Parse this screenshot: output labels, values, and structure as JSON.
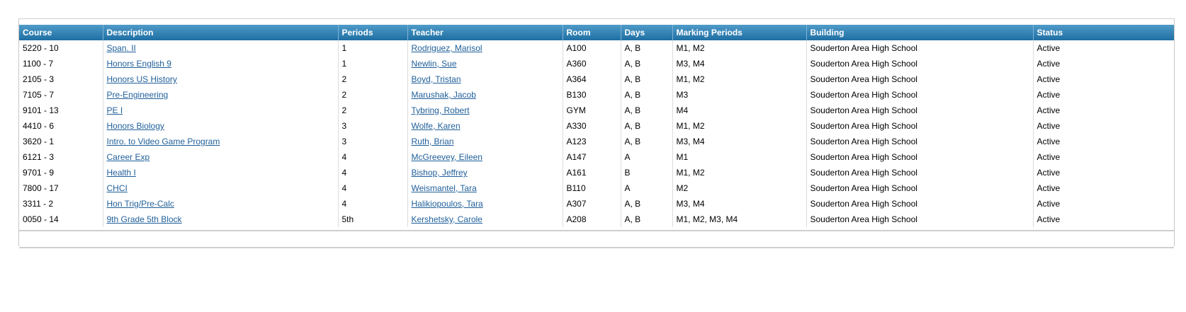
{
  "columns": [
    "Course",
    "Description",
    "Periods",
    "Teacher",
    "Room",
    "Days",
    "Marking Periods",
    "Building",
    "Status"
  ],
  "rows": [
    {
      "course": "5220 - 10",
      "description": "Span. II",
      "periods": "1",
      "teacher": "Rodriguez, Marisol",
      "room": "A100",
      "days": "A, B",
      "marking_periods": "M1, M2",
      "building": "Souderton Area High School",
      "status": "Active"
    },
    {
      "course": "1100 - 7",
      "description": "Honors English 9",
      "periods": "1",
      "teacher": "Newlin, Sue",
      "room": "A360",
      "days": "A, B",
      "marking_periods": "M3, M4",
      "building": "Souderton Area High School",
      "status": "Active"
    },
    {
      "course": "2105 - 3",
      "description": "Honors US History",
      "periods": "2",
      "teacher": "Boyd, Tristan",
      "room": "A364",
      "days": "A, B",
      "marking_periods": "M1, M2",
      "building": "Souderton Area High School",
      "status": "Active"
    },
    {
      "course": "7105 - 7",
      "description": "Pre-Engineering",
      "periods": "2",
      "teacher": "Marushak, Jacob",
      "room": "B130",
      "days": "A, B",
      "marking_periods": "M3",
      "building": "Souderton Area High School",
      "status": "Active"
    },
    {
      "course": "9101 - 13",
      "description": "PE I",
      "periods": "2",
      "teacher": "Tybring, Robert",
      "room": "GYM",
      "days": "A, B",
      "marking_periods": "M4",
      "building": "Souderton Area High School",
      "status": "Active"
    },
    {
      "course": "4410 - 6",
      "description": "Honors Biology",
      "periods": "3",
      "teacher": "Wolfe, Karen",
      "room": "A330",
      "days": "A, B",
      "marking_periods": "M1, M2",
      "building": "Souderton Area High School",
      "status": "Active"
    },
    {
      "course": "3620 - 1",
      "description": "Intro. to Video Game Program",
      "periods": "3",
      "teacher": "Ruth, Brian",
      "room": "A123",
      "days": "A, B",
      "marking_periods": "M3, M4",
      "building": "Souderton Area High School",
      "status": "Active"
    },
    {
      "course": "6121 - 3",
      "description": "Career Exp",
      "periods": "4",
      "teacher": "McGreevey, Eileen",
      "room": "A147",
      "days": "A",
      "marking_periods": "M1",
      "building": "Souderton Area High School",
      "status": "Active"
    },
    {
      "course": "9701 - 9",
      "description": "Health I",
      "periods": "4",
      "teacher": "Bishop, Jeffrey",
      "room": "A161",
      "days": "B",
      "marking_periods": "M1, M2",
      "building": "Souderton Area High School",
      "status": "Active"
    },
    {
      "course": "7800 - 17",
      "description": "CHCI",
      "periods": "4",
      "teacher": "Weismantel, Tara",
      "room": "B110",
      "days": "A",
      "marking_periods": "M2",
      "building": "Souderton Area High School",
      "status": "Active"
    },
    {
      "course": "3311 - 2",
      "description": "Hon Trig/Pre-Calc",
      "periods": "4",
      "teacher": "Halikiopoulos, Tara",
      "room": "A307",
      "days": "A, B",
      "marking_periods": "M3, M4",
      "building": "Souderton Area High School",
      "status": "Active"
    },
    {
      "course": "0050 - 14",
      "description": "9th Grade 5th Block",
      "periods": "5th",
      "teacher": "Kershetsky, Carole",
      "room": "A208",
      "days": "A, B",
      "marking_periods": "M1, M2, M3, M4",
      "building": "Souderton Area High School",
      "status": "Active"
    }
  ]
}
